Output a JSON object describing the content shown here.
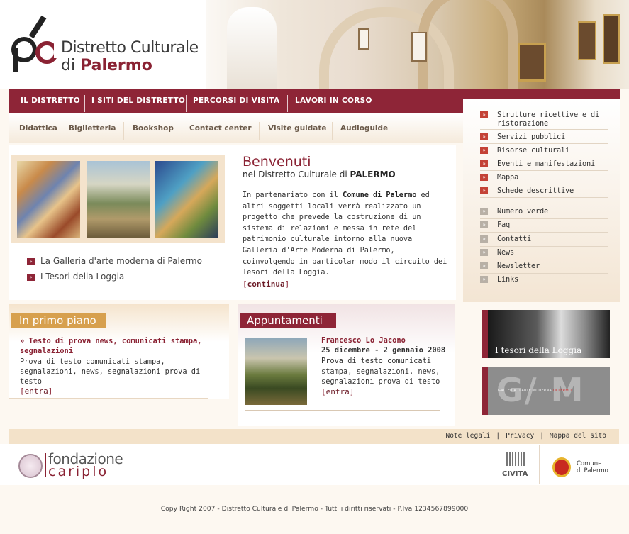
{
  "header": {
    "logo_line1": "Distretto Culturale",
    "logo_line2_prefix": "di ",
    "logo_line2_bold": "Palermo"
  },
  "main_nav": [
    "IL DISTRETTO",
    "I SITI DEL DISTRETTO",
    "PERCORSI DI VISITA",
    "LAVORI IN CORSO"
  ],
  "sub_nav": [
    "Didattica",
    "Biglietteria",
    "Bookshop",
    "Contact center",
    "Visite guidate",
    "Audioguide"
  ],
  "welcome": {
    "title": "Benvenuti",
    "subtitle_prefix": "nel Distretto Culturale di ",
    "subtitle_bold": "PALERMO",
    "body_part1": "In partenariato con il ",
    "body_bold": "Comune di Palermo",
    "body_part2": " ed altri soggetti locali verrà realizzato un progetto che prevede la costruzione di un sistema di relazioni e messa in rete del patrimonio culturale intorno alla nuova Galleria d'Arte Moderna di Palermo, coinvolgendo in particolar modo il circuito dei Tesori della Loggia.",
    "more_label": "continua",
    "links": [
      "La Galleria d'arte moderna di Palermo",
      "I Tesori della Loggia"
    ]
  },
  "right_menu": {
    "primary": [
      "Strutture ricettive e di ristorazione",
      "Servizi pubblici",
      "Risorse culturali",
      "Eventi e manifestazioni",
      "Mappa",
      "Schede  descrittive"
    ],
    "secondary": [
      "Numero verde",
      "Faq",
      "Contatti",
      "News",
      "Newsletter",
      "Links"
    ]
  },
  "promos": {
    "loggia_label": "I tesori della Loggia",
    "gam_big": "G/ M",
    "gam_small_1": "GALLERIA D'ARTE MODERNA ",
    "gam_small_2": "DI LERMO"
  },
  "primo_piano": {
    "heading": "In primo piano",
    "title": "» Testo di prova news, comunicati stampa, segnalazioni",
    "body": "Prova di testo comunicati stampa, segnalazioni, news, segnalazioni prova di testo",
    "more_label": "entra"
  },
  "appuntamenti": {
    "heading": "Appuntamenti",
    "name": "Francesco Lo Jacono",
    "date": "25 dicembre - 2 gennaio 2008",
    "body": "Prova di testo comunicati stampa, segnalazioni, news, segnalazioni prova di testo",
    "more_label": "entra"
  },
  "footer": {
    "links": [
      "Note legali",
      "Privacy",
      "Mappa del sito"
    ],
    "separator": "|",
    "cariplo_1": "fondazione",
    "cariplo_2": "cariplo",
    "civita": "CIVITA",
    "comune_1": "Comune",
    "comune_2": "di Palermo",
    "copyright": "Copy Right 2007 - Distretto Culturale di Palermo - Tutti i diritti riservati - P.Iva 1234567899000"
  }
}
